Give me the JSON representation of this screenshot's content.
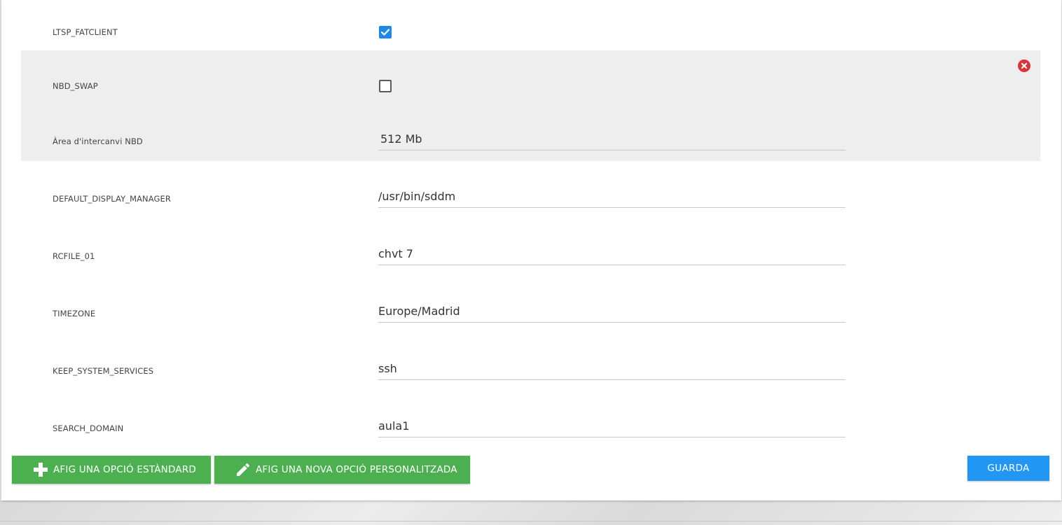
{
  "options": [
    {
      "label": "LTSP_FATCLIENT",
      "type": "checkbox",
      "checked": true
    },
    {
      "label": "NBD_SWAP",
      "type": "checkbox",
      "checked": false
    },
    {
      "label": "Àrea d'intercanvi NBD",
      "type": "text",
      "value": "512 Mb"
    },
    {
      "label": "DEFAULT_DISPLAY_MANAGER",
      "type": "text",
      "value": "/usr/bin/sddm"
    },
    {
      "label": "RCFILE_01",
      "type": "text",
      "value": "chvt 7"
    },
    {
      "label": "TIMEZONE",
      "type": "text",
      "value": "Europe/Madrid"
    },
    {
      "label": "KEEP_SYSTEM_SERVICES",
      "type": "text",
      "value": "ssh"
    },
    {
      "label": "SEARCH_DOMAIN",
      "type": "text",
      "value": "aula1"
    }
  ],
  "actions": {
    "add_standard_label": "AFIG UNA OPCIÓ ESTÀNDARD",
    "add_custom_label": "AFIG UNA NOVA OPCIÓ PERSONALITZADA",
    "save_label": "GUARDA"
  },
  "icons": {
    "add_standard": "plus-icon",
    "add_custom": "pencil-icon",
    "remove_group": "close-circle-icon",
    "checkbox_checked": "check-icon"
  },
  "colors": {
    "checkbox_accent": "#1e88e5",
    "group_background": "#eeeeee",
    "remove_button": "#d9343a",
    "green_button": "#4caf50",
    "save_button": "#2196f3"
  }
}
